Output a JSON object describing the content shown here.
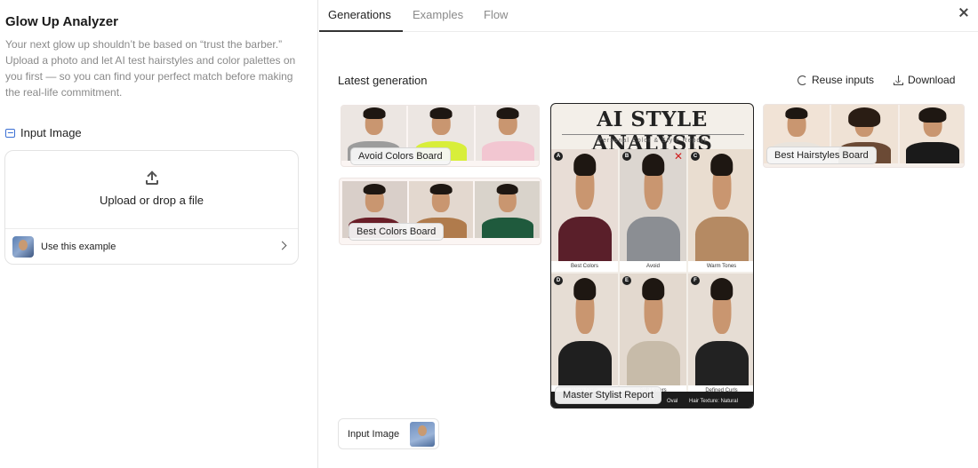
{
  "app": {
    "title": "Glow Up Analyzer",
    "description": "Your next glow up shouldn’t be based on “trust the barber.” Upload a photo and let AI test hairstyles and color palettes on you first — so you can find your perfect match before making the real-life commitment."
  },
  "input": {
    "label": "Input Image",
    "upload_text": "Upload or drop a file",
    "example_label": "Use this example"
  },
  "tabs": [
    {
      "label": "Generations",
      "active": true
    },
    {
      "label": "Examples",
      "active": false
    },
    {
      "label": "Flow",
      "active": false
    }
  ],
  "toolbar": {
    "latest_label": "Latest generation",
    "reuse_label": "Reuse inputs",
    "download_label": "Download"
  },
  "cards": {
    "avoid": "Avoid Colors Board",
    "best": "Best Colors Board",
    "hairstyles": "Best Hairstyles Board",
    "report": "Master Stylist Report"
  },
  "report": {
    "title": "AI STYLE ANALYSIS",
    "subtitle": "Personal Color & Style Report",
    "cells": [
      {
        "badge": "A",
        "caption": "Best Colors",
        "shirt": "#5a1f2a",
        "bg": "#e8ddd6"
      },
      {
        "badge": "B",
        "caption": "Avoid",
        "shirt": "#8b8e93",
        "bg": "#dcd6d0"
      },
      {
        "badge": "C",
        "caption": "Warm Tones",
        "shirt": "#b58a63",
        "bg": "#e9ddd0"
      },
      {
        "badge": "D",
        "caption": "Wavy Curls",
        "shirt": "#1f1f1f",
        "bg": "#e6ddd4"
      },
      {
        "badge": "E",
        "caption": "Soft Layers",
        "shirt": "#c7bba9",
        "bg": "#e3d9cf"
      },
      {
        "badge": "F",
        "caption": "Defined Curls",
        "shirt": "#222222",
        "bg": "#e6ddd4"
      }
    ],
    "footer_left": "Oval",
    "footer_right": "Hair Texture: Natural"
  },
  "chip": {
    "label": "Input Image"
  }
}
